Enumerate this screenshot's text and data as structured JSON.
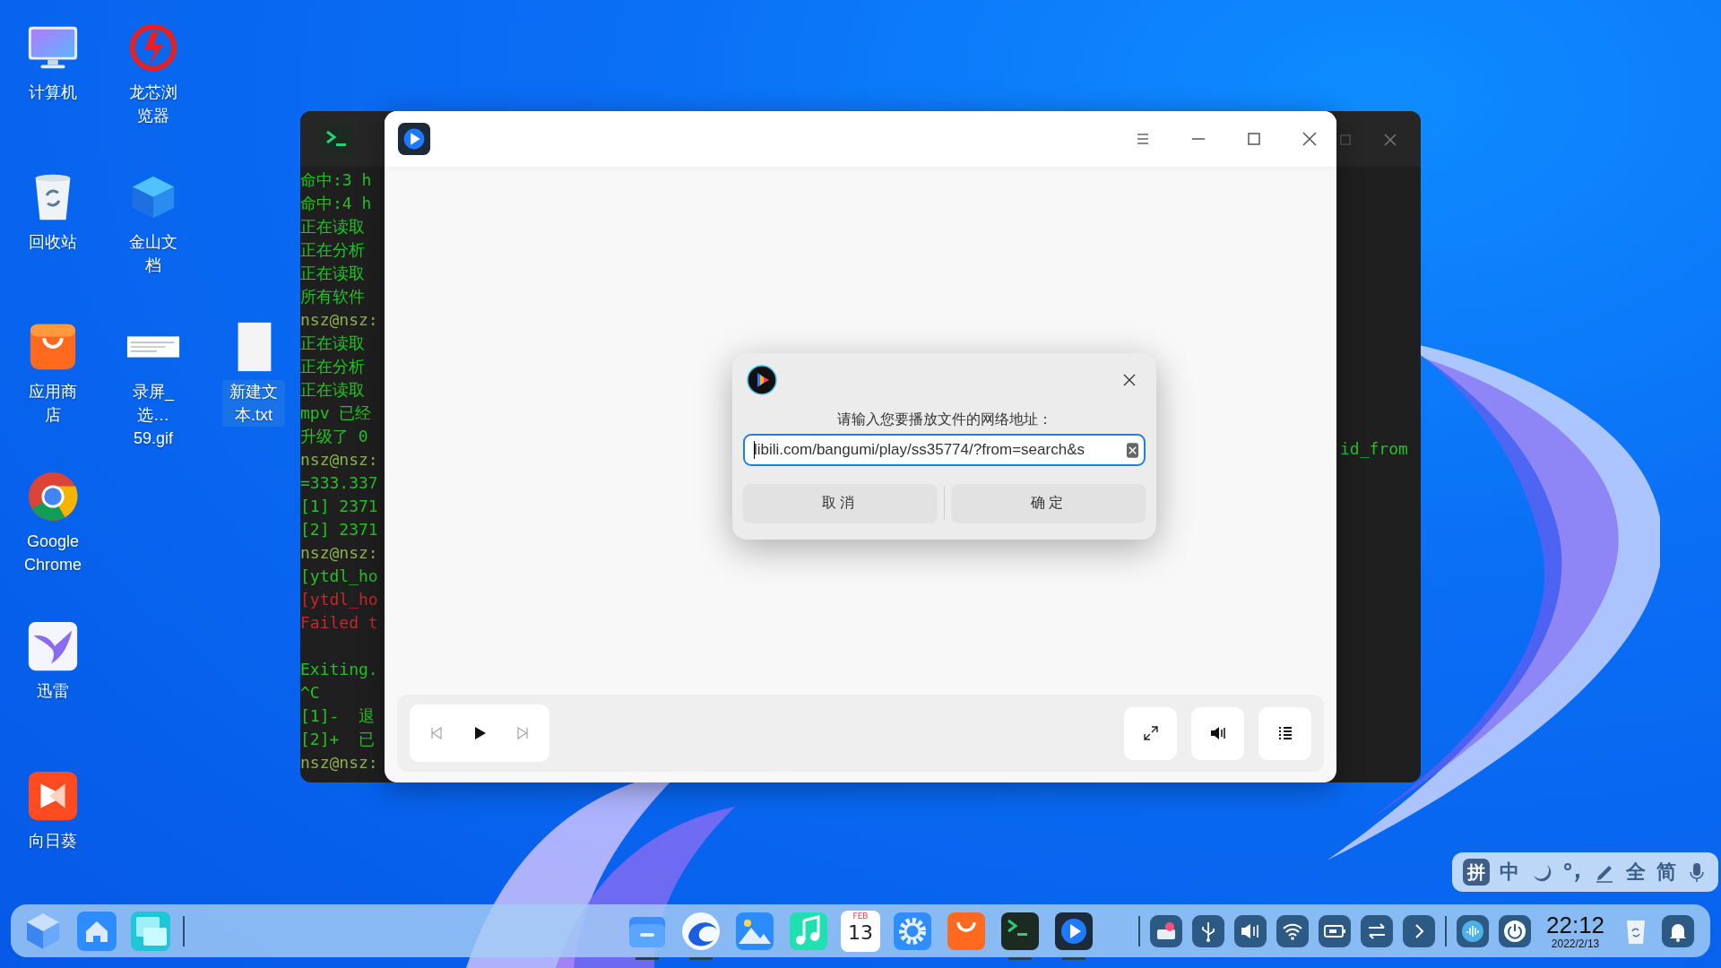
{
  "desktop": {
    "columns": [
      {
        "items": [
          {
            "label": "计算机",
            "kind": "computer",
            "selected": false
          },
          {
            "label": "回收站",
            "kind": "trash",
            "selected": false
          },
          {
            "label": "应用商店",
            "kind": "store",
            "selected": false
          },
          {
            "label": "Google Chrome",
            "kind": "chrome",
            "selected": false
          },
          {
            "label": "迅雷",
            "kind": "bird",
            "selected": false
          },
          {
            "label": "向日葵",
            "kind": "remote",
            "selected": false
          }
        ]
      },
      {
        "items": [
          {
            "label": "龙芯浏览器",
            "kind": "browser",
            "selected": false
          },
          {
            "label": "金山文档",
            "kind": "docs",
            "selected": false
          },
          {
            "label": "录屏_选…59.gif",
            "kind": "image",
            "selected": false
          }
        ]
      },
      {
        "items": [
          {
            "label": "新建文本.txt",
            "kind": "textfile",
            "selected": true
          }
        ]
      }
    ]
  },
  "terminal": {
    "lines": [
      {
        "text": "命中:3 h",
        "kind": "out"
      },
      {
        "text": "命中:4 h",
        "kind": "out"
      },
      {
        "text": "正在读取",
        "kind": "out"
      },
      {
        "text": "正在分析",
        "kind": "out"
      },
      {
        "text": "正在读取",
        "kind": "out"
      },
      {
        "text": "所有软件",
        "kind": "out"
      },
      {
        "text": "nsz@nsz:",
        "kind": "prompt"
      },
      {
        "text": "正在读取",
        "kind": "out"
      },
      {
        "text": "正在分析",
        "kind": "out"
      },
      {
        "text": "正在读取",
        "kind": "out"
      },
      {
        "text": "mpv 已经",
        "kind": "out"
      },
      {
        "text": "升级了 0",
        "kind": "out"
      },
      {
        "text": "nsz@nsz:",
        "kind": "prompt"
      },
      {
        "text": "=333.337",
        "kind": "out"
      },
      {
        "text": "[1] 2371",
        "kind": "out"
      },
      {
        "text": "[2] 2371",
        "kind": "out"
      },
      {
        "text": "nsz@nsz:",
        "kind": "prompt"
      },
      {
        "text": "[ytdl_ho",
        "kind": "out"
      },
      {
        "text": "[ytdl_ho",
        "kind": "error"
      },
      {
        "text": "Failed t",
        "kind": "error"
      },
      {
        "kind": "blank"
      },
      {
        "text": "Exiting.",
        "kind": "out"
      },
      {
        "text": "^C",
        "kind": "out"
      },
      {
        "text": "[1]-  退",
        "kind": "out"
      },
      {
        "text": "[2]+  已",
        "kind": "out"
      },
      {
        "text": "nsz@nsz:",
        "kind": "prompt"
      }
    ],
    "right_fragment": "id_from"
  },
  "dialog": {
    "prompt": "请输入您要播放文件的网络地址：",
    "url": "libili.com/bangumi/play/ss35774/?from=search&s",
    "buttons": [
      "取消",
      "确定"
    ]
  },
  "taskbar": {
    "left": [
      {
        "kind": "launcher"
      },
      {
        "kind": "home"
      },
      {
        "kind": "multitask"
      }
    ],
    "apps": [
      {
        "kind": "files",
        "running": true
      },
      {
        "kind": "browser",
        "running": true
      },
      {
        "kind": "photos",
        "running": false
      },
      {
        "kind": "music",
        "running": false
      },
      {
        "kind": "calendar",
        "running": false,
        "month": "FEB",
        "day": "13"
      },
      {
        "kind": "settings",
        "running": false
      },
      {
        "kind": "store",
        "running": false
      },
      {
        "kind": "terminal",
        "running": true
      },
      {
        "kind": "player",
        "running": true
      }
    ],
    "tray": [
      {
        "kind": "keyboard"
      },
      {
        "kind": "usb"
      },
      {
        "kind": "volume"
      },
      {
        "kind": "wifi"
      },
      {
        "kind": "battery"
      },
      {
        "kind": "switch"
      },
      {
        "kind": "expand"
      }
    ],
    "time": "22:12",
    "date": "2022/2/13"
  },
  "ime_bar": {
    "items": [
      {
        "kind": "badge",
        "text": "拼"
      },
      {
        "kind": "text",
        "text": "中"
      },
      {
        "kind": "moon"
      },
      {
        "kind": "punct"
      },
      {
        "kind": "pen"
      },
      {
        "kind": "text",
        "text": "全"
      },
      {
        "kind": "text",
        "text": "简"
      },
      {
        "kind": "mic"
      }
    ]
  }
}
